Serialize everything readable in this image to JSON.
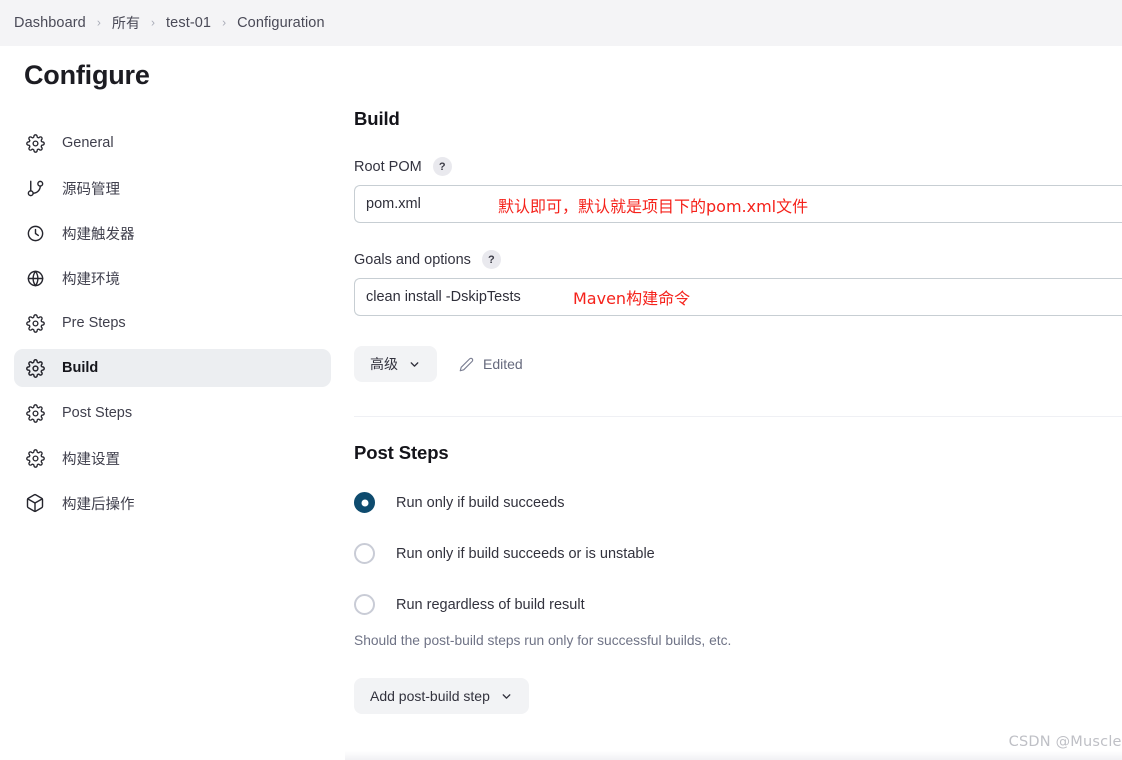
{
  "breadcrumb": {
    "separator": "›",
    "items": [
      {
        "label": "Dashboard"
      },
      {
        "label": "所有"
      },
      {
        "label": "test-01"
      },
      {
        "label": "Configuration"
      }
    ]
  },
  "sidebar": {
    "title": "Configure",
    "items": [
      {
        "label": "General",
        "icon": "gear-icon"
      },
      {
        "label": "源码管理",
        "icon": "git-branch-icon"
      },
      {
        "label": "构建触发器",
        "icon": "clock-icon"
      },
      {
        "label": "构建环境",
        "icon": "globe-icon"
      },
      {
        "label": "Pre Steps",
        "icon": "gear-icon"
      },
      {
        "label": "Build",
        "icon": "gear-icon"
      },
      {
        "label": "Post Steps",
        "icon": "gear-icon"
      },
      {
        "label": "构建设置",
        "icon": "gear-icon"
      },
      {
        "label": "构建后操作",
        "icon": "package-icon"
      }
    ],
    "active_index": 5
  },
  "build": {
    "heading": "Build",
    "root_pom": {
      "label": "Root POM",
      "help": "?",
      "value": "pom.xml",
      "annotation": "默认即可，默认就是项目下的pom.xml文件"
    },
    "goals": {
      "label": "Goals and options",
      "help": "?",
      "value": "clean install -DskipTests",
      "annotation": "Maven构建命令"
    },
    "advanced_button": "高级",
    "edited_label": "Edited"
  },
  "post_steps": {
    "heading": "Post Steps",
    "options": [
      {
        "label": "Run only if build succeeds",
        "selected": true
      },
      {
        "label": "Run only if build succeeds or is unstable",
        "selected": false
      },
      {
        "label": "Run regardless of build result",
        "selected": false
      }
    ],
    "hint": "Should the post-build steps run only for successful builds, etc.",
    "add_button": "Add post-build step"
  },
  "watermark": "CSDN @Muscleheng",
  "colors": {
    "header_bg": "#f4f4f6",
    "active_nav_bg": "#eceef1",
    "radio_selected": "#0e4b6e",
    "annotation_red": "#f5221b",
    "input_border": "#c7ced3"
  }
}
